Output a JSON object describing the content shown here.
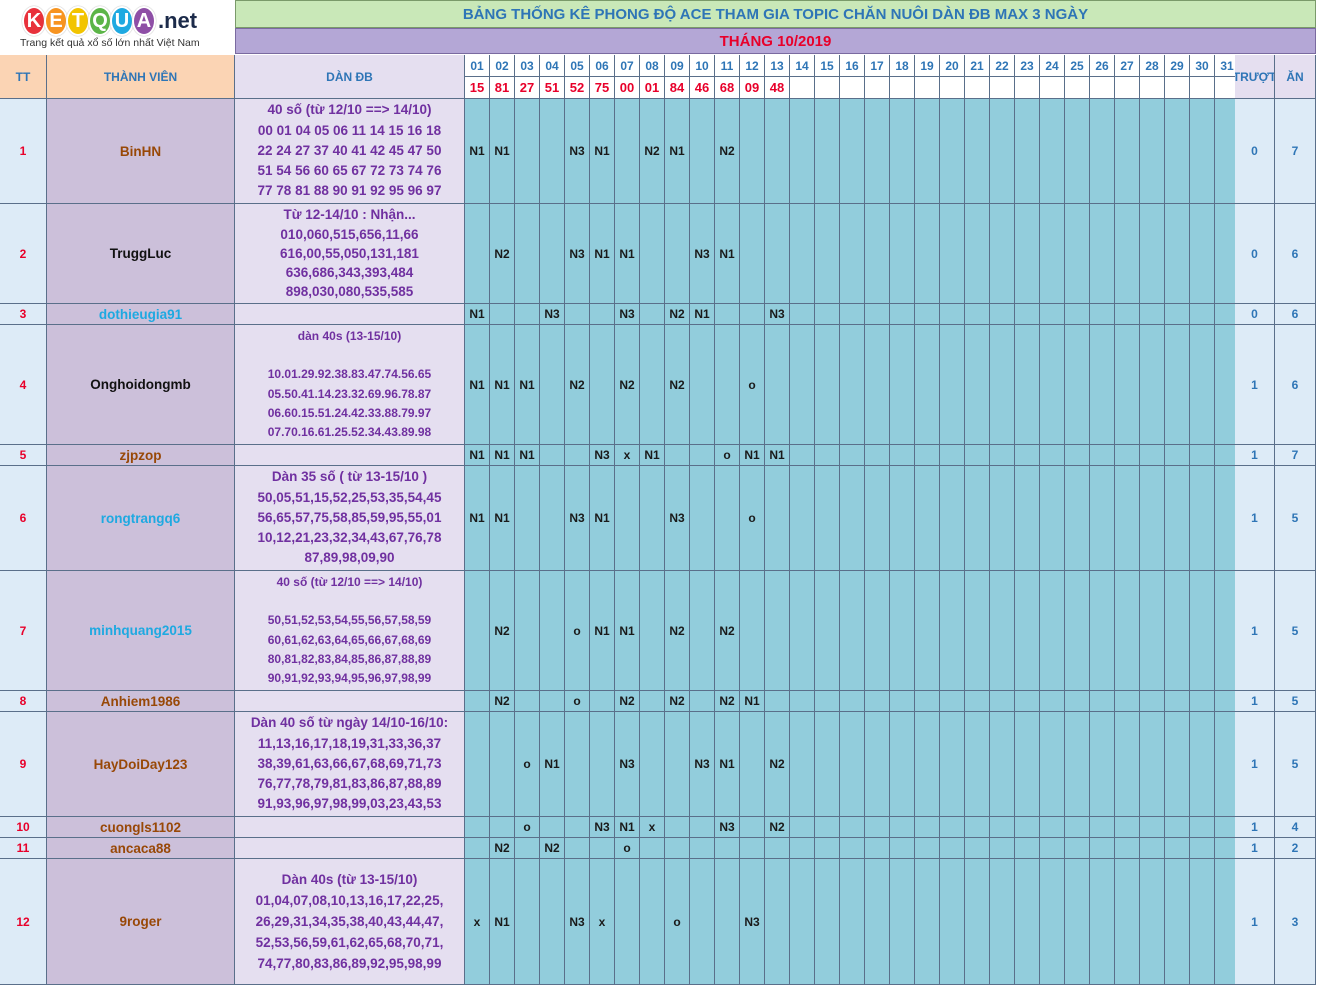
{
  "logo": {
    "letters": [
      "K",
      "E",
      "T",
      "Q",
      "U",
      "A"
    ],
    "letter_colors": [
      "#e8313b",
      "#f79420",
      "#f2c400",
      "#5bb547",
      "#1ea9e1",
      "#8e4fa6"
    ],
    "suffix": ".net",
    "tagline": "Trang kết quả xổ số lớn nhất Việt Nam"
  },
  "title": "BẢNG THỐNG KÊ PHONG ĐỘ ACE THAM GIA TOPIC CHĂN NUÔI DÀN ĐB MAX 3 NGÀY",
  "month": "THÁNG 10/2019",
  "headers": {
    "tt": "TT",
    "member": "THÀNH VIÊN",
    "dan": "DÀN ĐB",
    "truot": "TRƯỢT",
    "an": "ĂN"
  },
  "days": [
    "01",
    "02",
    "03",
    "04",
    "05",
    "06",
    "07",
    "08",
    "09",
    "10",
    "11",
    "12",
    "13",
    "14",
    "15",
    "16",
    "17",
    "18",
    "19",
    "20",
    "21",
    "22",
    "23",
    "24",
    "25",
    "26",
    "27",
    "28",
    "29",
    "30",
    "31"
  ],
  "results": [
    "15",
    "81",
    "27",
    "51",
    "52",
    "75",
    "00",
    "01",
    "84",
    "46",
    "68",
    "09",
    "48",
    "",
    "",
    "",
    "",
    "",
    "",
    "",
    "",
    "",
    "",
    "",
    "",
    "",
    "",
    "",
    "",
    "",
    ""
  ],
  "colors": {
    "name_brown": "#984807",
    "name_black": "#111111",
    "name_blue": "#1ea9e1"
  },
  "members": [
    {
      "tt": "1",
      "name": "BinHN",
      "name_color": "#984807",
      "dan_lines": [
        "40 số (từ 12/10 ==> 14/10)",
        "00 01 04 05 06 11 14 15 16 18",
        "22 24 27 37 40 41 42 45 47 50",
        "51 54 56 60 65 67 72 73 74 76",
        "77 78 81 88 90 91 92 95 96 97"
      ],
      "marks": {
        "1": "N1",
        "2": "N1",
        "5": "N3",
        "6": "N1",
        "8": "N2",
        "9": "N1",
        "11": "N2"
      },
      "truot": "0",
      "an": "7"
    },
    {
      "tt": "2",
      "name": "TruggLuc",
      "name_color": "#111111",
      "dan_lines": [
        "Từ 12-14/10 : Nhận...",
        "010,060,515,656,11,66",
        "616,00,55,050,131,181",
        "636,686,343,393,484",
        "898,030,080,535,585"
      ],
      "marks": {
        "2": "N2",
        "5": "N3",
        "6": "N1",
        "7": "N1",
        "10": "N3",
        "11": "N1"
      },
      "truot": "0",
      "an": "6"
    },
    {
      "tt": "3",
      "name": "dothieugia91",
      "name_color": "#1ea9e1",
      "dan_lines": [],
      "marks": {
        "1": "N1",
        "4": "N3",
        "7": "N3",
        "9": "N2",
        "10": "N1",
        "13": "N3"
      },
      "truot": "0",
      "an": "6"
    },
    {
      "tt": "4",
      "name": "Onghoidongmb",
      "name_color": "#111111",
      "dan_lines": [
        "dàn 40s (13-15/10)",
        "",
        "10.01.29.92.38.83.47.74.56.65",
        "05.50.41.14.23.32.69.96.78.87",
        "06.60.15.51.24.42.33.88.79.97",
        "07.70.16.61.25.52.34.43.89.98"
      ],
      "marks": {
        "1": "N1",
        "2": "N1",
        "3": "N1",
        "5": "N2",
        "7": "N2",
        "9": "N2",
        "12": "o"
      },
      "truot": "1",
      "an": "6"
    },
    {
      "tt": "5",
      "name": "zjpzop",
      "name_color": "#984807",
      "dan_lines": [],
      "marks": {
        "1": "N1",
        "2": "N1",
        "3": "N1",
        "6": "N3",
        "7": "x",
        "8": "N1",
        "11": "o",
        "12": "N1",
        "13": "N1"
      },
      "truot": "1",
      "an": "7"
    },
    {
      "tt": "6",
      "name": "rongtrangq6",
      "name_color": "#1ea9e1",
      "dan_lines": [
        "Dàn 35 số ( từ 13-15/10 )",
        "50,05,51,15,52,25,53,35,54,45",
        "56,65,57,75,58,85,59,95,55,01",
        "10,12,21,23,32,34,43,67,76,78",
        "87,89,98,09,90"
      ],
      "marks": {
        "1": "N1",
        "2": "N1",
        "5": "N3",
        "6": "N1",
        "9": "N3",
        "12": "o"
      },
      "truot": "1",
      "an": "5"
    },
    {
      "tt": "7",
      "name": "minhquang2015",
      "name_color": "#1ea9e1",
      "dan_lines": [
        "40 số (từ 12/10 ==> 14/10)",
        "",
        "50,51,52,53,54,55,56,57,58,59",
        "60,61,62,63,64,65,66,67,68,69",
        "80,81,82,83,84,85,86,87,88,89",
        "90,91,92,93,94,95,96,97,98,99"
      ],
      "marks": {
        "2": "N2",
        "5": "o",
        "6": "N1",
        "7": "N1",
        "9": "N2",
        "11": "N2"
      },
      "truot": "1",
      "an": "5"
    },
    {
      "tt": "8",
      "name": "Anhiem1986",
      "name_color": "#984807",
      "dan_lines": [],
      "marks": {
        "2": "N2",
        "5": "o",
        "7": "N2",
        "9": "N2",
        "11": "N2",
        "12": "N1"
      },
      "truot": "1",
      "an": "5"
    },
    {
      "tt": "9",
      "name": "HayDoiDay123",
      "name_color": "#984807",
      "dan_lines": [
        "Dàn 40 số từ ngày 14/10-16/10:",
        "11,13,16,17,18,19,31,33,36,37",
        "38,39,61,63,66,67,68,69,71,73",
        "76,77,78,79,81,83,86,87,88,89",
        "91,93,96,97,98,99,03,23,43,53"
      ],
      "marks": {
        "3": "o",
        "4": "N1",
        "7": "N3",
        "10": "N3",
        "11": "N1",
        "13": "N2"
      },
      "truot": "1",
      "an": "5"
    },
    {
      "tt": "10",
      "name": "cuongls1102",
      "name_color": "#984807",
      "dan_lines": [],
      "marks": {
        "3": "o",
        "6": "N3",
        "7": "N1",
        "8": "x",
        "11": "N3",
        "13": "N2"
      },
      "truot": "1",
      "an": "4"
    },
    {
      "tt": "11",
      "name": "ancaca88",
      "name_color": "#984807",
      "dan_lines": [],
      "marks": {
        "2": "N2",
        "4": "N2",
        "7": "o"
      },
      "truot": "1",
      "an": "2"
    },
    {
      "tt": "12",
      "name": "9roger",
      "name_color": "#984807",
      "dan_lines": [
        "Dàn 40s (từ 13-15/10)",
        "01,04,07,08,10,13,16,17,22,25,",
        "26,29,31,34,35,38,40,43,44,47,",
        "52,53,56,59,61,62,65,68,70,71,",
        "74,77,80,83,86,89,92,95,98,99"
      ],
      "marks": {
        "1": "x",
        "2": "N1",
        "5": "N3",
        "6": "x",
        "9": "o",
        "12": "N3"
      },
      "truot": "1",
      "an": "3"
    }
  ]
}
